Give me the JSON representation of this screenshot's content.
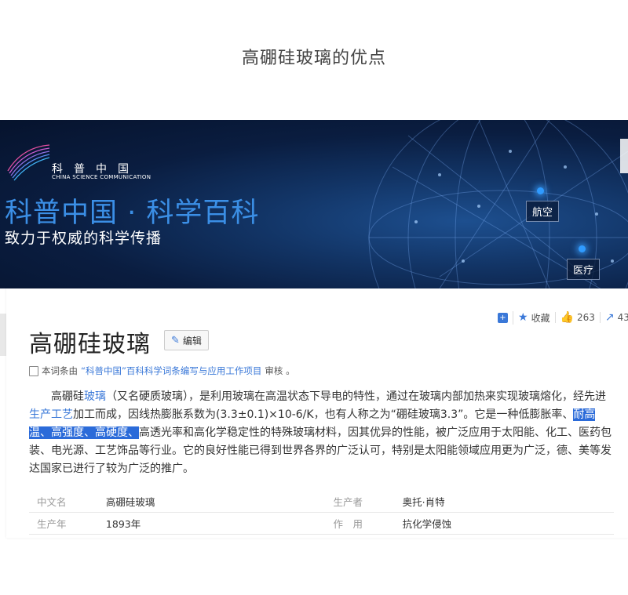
{
  "page": {
    "heading": "高硼硅玻璃的优点"
  },
  "banner": {
    "logo_text": "科普中国",
    "logo_subtext": "CHINA SCIENCE COMMUNICATION",
    "title": "科普中国 · 科学百科",
    "slogan": "致力于权威的科学传播",
    "tags": [
      "航空",
      "医疗"
    ]
  },
  "actions": {
    "favorite_label": "收藏",
    "like_count": "263",
    "share_count": "43"
  },
  "entry": {
    "title": "高硼硅玻璃",
    "edit_label": "编辑",
    "notice": {
      "prefix": "本词条由",
      "link": "“科普中国”百科科学词条编写与应用工作项目",
      "suffix": " 审核 。"
    },
    "paragraph": {
      "p1": "高硼硅",
      "link_glass": "玻璃",
      "p2": "（又名硬质玻璃），是利用玻璃在高温状态下导电的特性，通过在玻璃内部加热来实现玻璃熔化，经先进",
      "link_process": "生产工艺",
      "p3": "加工而成，因线热膨胀系数为(3.3±0.1)×10-6/K，也有人称之为“硼硅玻璃3.3”。它是一种低膨胀率、",
      "highlight": "耐高温、高强度、高硬度、",
      "p4": "高透光率和高化学稳定性的特殊玻璃材料，因其优异的性能，被广泛应用于太阳能、化工、医药包装、电光源、工艺饰品等行业。它的良好性能已得到世界各界的广泛认可，特别是太阳能领域应用更为广泛，德、美等发达国家已进行了较为广泛的推广。"
    },
    "info": [
      {
        "key": "中文名",
        "value": "高硼硅玻璃",
        "key2": "生产者",
        "value2": "奥托·肖特"
      },
      {
        "key": "生产年",
        "value": "1893年",
        "key2": "作　用",
        "value2": "抗化学侵蚀"
      }
    ]
  },
  "colors": {
    "accent": "#3a78d8",
    "banner_title": "#3b8fe6",
    "highlight": "#2b6bd9"
  }
}
